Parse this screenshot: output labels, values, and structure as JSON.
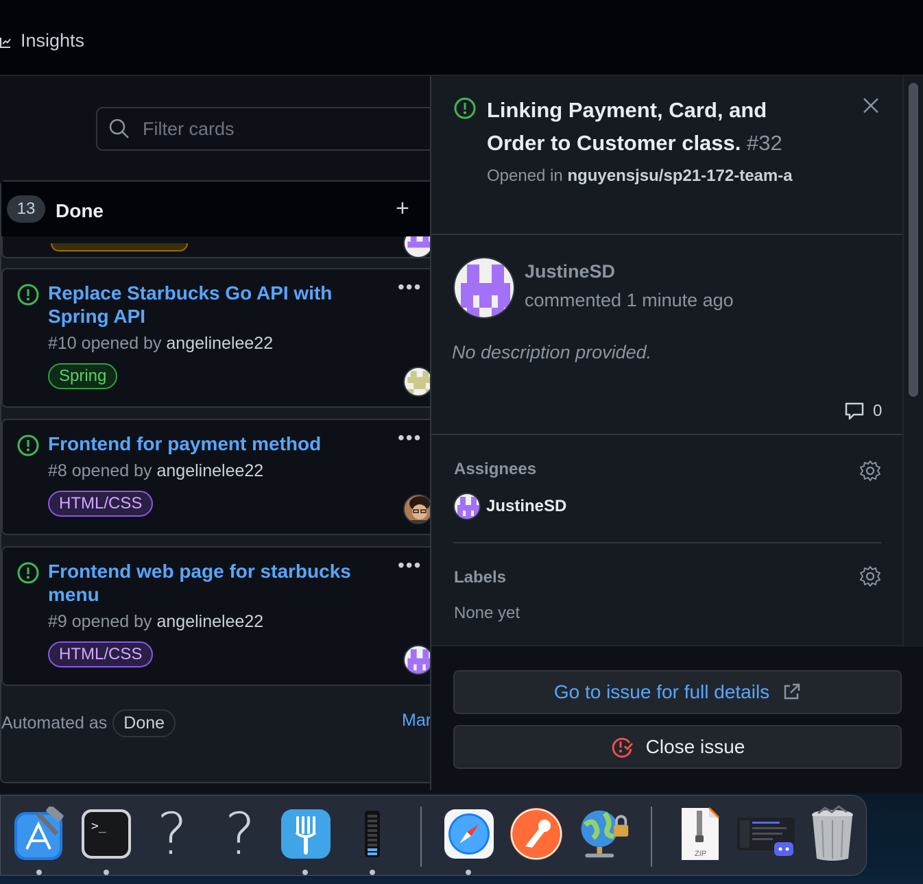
{
  "nav": {
    "insights_label": "Insights"
  },
  "board": {
    "filter_placeholder": "Filter cards",
    "column": {
      "count": "13",
      "title": "Done",
      "add_label": "+",
      "cards": [
        {
          "title": "Replace Starbucks Go API with Spring API",
          "number": "#10",
          "opened_by_text": "opened by",
          "author": "angelinelee22",
          "label": "Spring",
          "more": "•••"
        },
        {
          "title": "Frontend for payment method",
          "number": "#8",
          "opened_by_text": "opened by",
          "author": "angelinelee22",
          "label": "HTML/CSS",
          "more": "•••"
        },
        {
          "title": "Frontend web page for starbucks menu",
          "number": "#9",
          "opened_by_text": "opened by",
          "author": "angelinelee22",
          "label": "HTML/CSS",
          "more": "•••"
        }
      ],
      "footer": {
        "automated_as": "Automated as",
        "automated_value": "Done",
        "manage_label": "Mar"
      }
    }
  },
  "panel": {
    "title": "Linking Payment, Card, and Order to Customer class.",
    "number": "#32",
    "opened_in_text": "Opened in",
    "repo": "nguyensjsu/sp21-172-team-a",
    "comment": {
      "author": "JustineSD",
      "time": "commented 1 minute ago",
      "body": "No description provided.",
      "comment_count": "0"
    },
    "assignees": {
      "heading": "Assignees",
      "name": "JustineSD"
    },
    "labels": {
      "heading": "Labels",
      "empty": "None yet"
    },
    "go_to_issue_label": "Go to issue for full details",
    "close_issue_label": "Close issue"
  },
  "dock": {
    "zip_label": "ZIP",
    "question_mark": "?",
    "terminal_prompt": ">_"
  },
  "colors": {
    "open_issue": "#3fb950",
    "link": "#58a6ff",
    "close_issue_icon": "#f85149",
    "avatar_purple": "#a371f7"
  }
}
